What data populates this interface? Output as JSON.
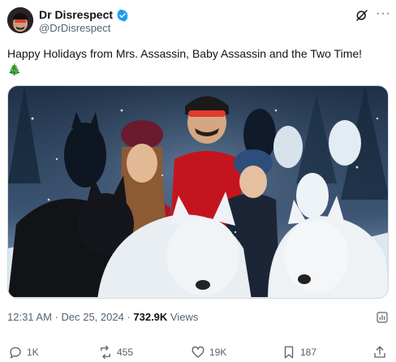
{
  "author": {
    "name": "Dr Disrespect",
    "handle": "@DrDisrespect",
    "verified_icon": "verified-badge-icon"
  },
  "header_icons": [
    "grok-icon",
    "more-icon"
  ],
  "more_label": "···",
  "tweet": {
    "text": "Happy Holidays from Mrs. Assassin, Baby Assassin and the Two Time!",
    "emoji": "🎄"
  },
  "meta": {
    "time": "12:31 AM · Dec 25, 2024 · ",
    "views_count": "732.9K",
    "views_label": " Views"
  },
  "actions": {
    "replies": "1K",
    "reposts": "455",
    "likes": "19K",
    "bookmarks": "187"
  },
  "colors": {
    "verified": "#1d9bf0",
    "muted": "#536471",
    "text": "#0f1419"
  }
}
